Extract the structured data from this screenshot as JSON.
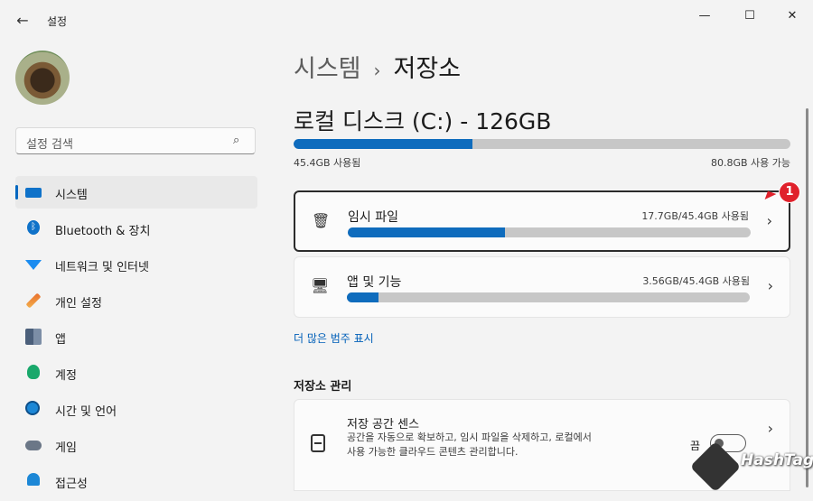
{
  "window": {
    "title": "설정",
    "back_glyph": "←",
    "minimize_glyph": "—",
    "maximize_glyph": "☐",
    "close_glyph": "✕"
  },
  "search": {
    "placeholder": "설정 검색",
    "icon": "search-icon"
  },
  "sidebar": {
    "items": [
      {
        "label": "시스템",
        "icon": "system-icon",
        "selected": true
      },
      {
        "label": "Bluetooth & 장치",
        "icon": "bluetooth-icon"
      },
      {
        "label": "네트워크 및 인터넷",
        "icon": "network-icon"
      },
      {
        "label": "개인 설정",
        "icon": "personalization-icon"
      },
      {
        "label": "앱",
        "icon": "apps-icon"
      },
      {
        "label": "계정",
        "icon": "accounts-icon"
      },
      {
        "label": "시간 및 언어",
        "icon": "time-language-icon"
      },
      {
        "label": "게임",
        "icon": "gaming-icon"
      },
      {
        "label": "접근성",
        "icon": "accessibility-icon"
      }
    ]
  },
  "breadcrumb": {
    "parent": "시스템",
    "separator": "›",
    "current": "저장소"
  },
  "disk": {
    "title": "로컬 디스크 (C:) - 126GB",
    "used_label": "45.4GB 사용됨",
    "available_label": "80.8GB 사용 가능",
    "used_fraction": 0.36,
    "bar_color": "#0f6cbd"
  },
  "categories": [
    {
      "label": "임시 파일",
      "usage": "17.7GB/45.4GB 사용됨",
      "fraction": 0.39,
      "icon": "trash-icon",
      "icon_glyph": "🗑"
    },
    {
      "label": "앱 및 기능",
      "usage": "3.56GB/45.4GB 사용됨",
      "fraction": 0.078,
      "icon": "apps-features-icon",
      "icon_glyph": "🖥"
    }
  ],
  "badge": {
    "number": "1",
    "color": "#e0212b"
  },
  "more_link": "더 많은 범주 표시",
  "management": {
    "section_title": "저장소 관리",
    "storage_sense": {
      "title": "저장 공간 센스",
      "description": "공간을 자동으로 확보하고, 임시 파일을 삭제하고, 로컬에서 사용 가능한 클라우드 콘텐츠 관리합니다.",
      "toggle_label": "끔",
      "toggle_on": false
    }
  },
  "chevron": "›",
  "watermark": "HashTag"
}
